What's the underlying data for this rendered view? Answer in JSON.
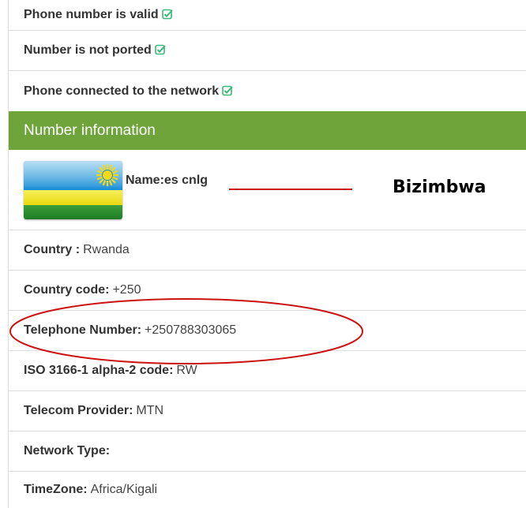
{
  "checks": [
    {
      "label": "Phone number is valid"
    },
    {
      "label": "Number is not ported"
    },
    {
      "label": "Phone connected to the network"
    }
  ],
  "header": {
    "title": "Number information"
  },
  "name_row": {
    "label": "Name:es cnlg",
    "annotation": "Bizimbwa",
    "flag_icon": "rwanda-flag-icon"
  },
  "details": [
    {
      "label": "Country :",
      "value": "Rwanda"
    },
    {
      "label": "Country code:",
      "value": "+250"
    },
    {
      "label": "Telephone Number:",
      "value": "+250788303065"
    },
    {
      "label": "ISO 3166-1 alpha-2 code:",
      "value": "RW"
    },
    {
      "label": "Telecom Provider:",
      "value": "MTN"
    },
    {
      "label": "Network Type:",
      "value": ""
    },
    {
      "label": "TimeZone:",
      "value": "Africa/Kigali"
    }
  ],
  "colors": {
    "header_bg": "#6fa43a",
    "check_icon": "#3cb878",
    "annotation_red": "#cc1111"
  }
}
